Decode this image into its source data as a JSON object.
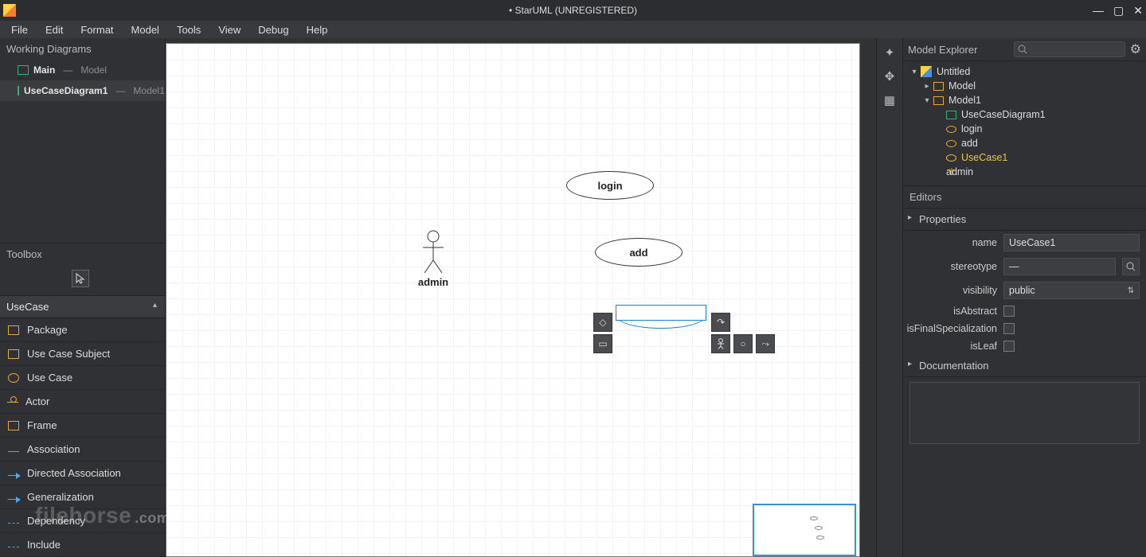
{
  "titlebar": {
    "title": "• StarUML (UNREGISTERED)"
  },
  "menubar": [
    "File",
    "Edit",
    "Format",
    "Model",
    "Tools",
    "View",
    "Debug",
    "Help"
  ],
  "workingDiagrams": {
    "title": "Working Diagrams",
    "items": [
      {
        "name": "Main",
        "scope": "Model"
      },
      {
        "name": "UseCaseDiagram1",
        "scope": "Model1"
      }
    ]
  },
  "toolbox": {
    "title": "Toolbox",
    "group": "UseCase",
    "items": [
      "Package",
      "Use Case Subject",
      "Use Case",
      "Actor",
      "Frame",
      "Association",
      "Directed Association",
      "Generalization",
      "Dependency",
      "Include"
    ]
  },
  "canvas": {
    "actor": {
      "label": "admin"
    },
    "uc1": {
      "label": "login"
    },
    "uc2": {
      "label": "add"
    }
  },
  "modelExplorer": {
    "title": "Model Explorer",
    "root": "Untitled",
    "model": "Model",
    "model1": "Model1",
    "children": [
      "UseCaseDiagram1",
      "login",
      "add",
      "UseCase1",
      "admin"
    ]
  },
  "editors": {
    "title": "Editors",
    "propertiesTitle": "Properties",
    "properties": {
      "nameLabel": "name",
      "nameValue": "UseCase1",
      "stereotypeLabel": "stereotype",
      "stereotypeValue": "—",
      "visibilityLabel": "visibility",
      "visibilityValue": "public",
      "isAbstractLabel": "isAbstract",
      "isFinalSpecializationLabel": "isFinalSpecialization",
      "isLeafLabel": "isLeaf"
    },
    "documentationTitle": "Documentation"
  },
  "watermark": {
    "text": "filehorse",
    "tld": ".com"
  }
}
